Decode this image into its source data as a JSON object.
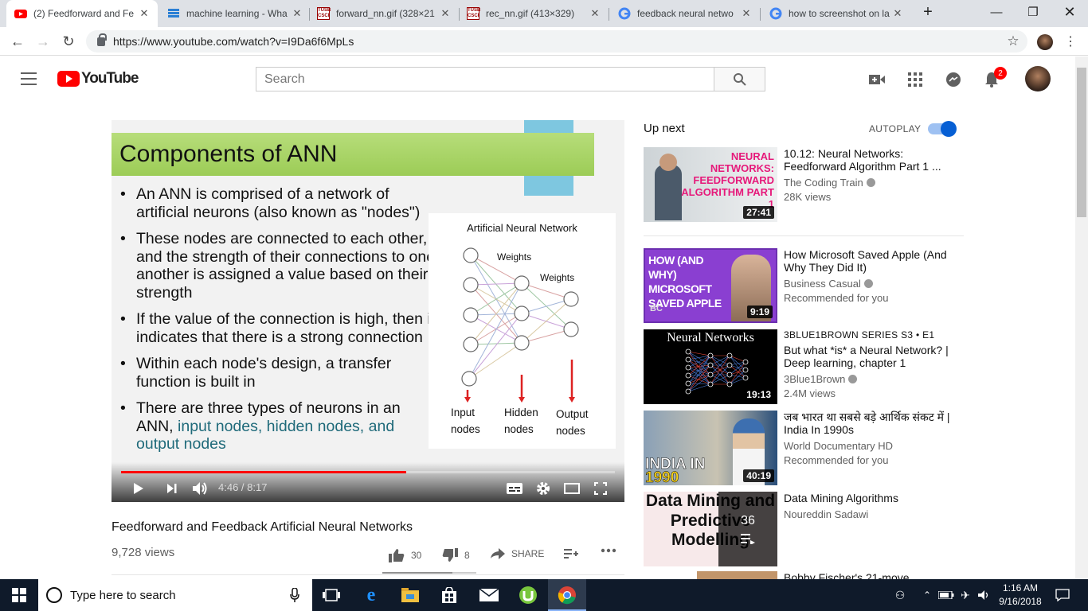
{
  "browser": {
    "tabs": [
      {
        "title": "(2) Feedforward and Fe",
        "active": true,
        "icon": "youtube-favicon"
      },
      {
        "title": "machine learning - Wha",
        "active": false,
        "icon": "stackexchange-favicon"
      },
      {
        "title": "forward_nn.gif (328×21",
        "active": false,
        "icon": "usc-csci-favicon"
      },
      {
        "title": "rec_nn.gif (413×329)",
        "active": false,
        "icon": "usc-csci-favicon"
      },
      {
        "title": "feedback neural netwo",
        "active": false,
        "icon": "google-favicon"
      },
      {
        "title": "how to screenshot on la",
        "active": false,
        "icon": "google-favicon"
      }
    ],
    "url": "https://www.youtube.com/watch?v=I9Da6f6MpLs",
    "fav_csci_top": "TUSB",
    "fav_csci_bottom": "CSCI"
  },
  "youtube": {
    "logo_text": "YouTube",
    "search_placeholder": "Search",
    "notification_count": "2"
  },
  "video": {
    "slide": {
      "title": "Components of ANN",
      "bullets": [
        "An ANN is comprised of a network of artificial neurons (also known as \"nodes\")",
        "These nodes are connected to each other, and the strength of their connections to one another is assigned a value based on their strength",
        "If the value of the connection is high, then it indicates that there is a strong connection",
        "Within each node's design, a transfer function is built in"
      ],
      "last_bullet_plain": "There are three types of neurons in an ANN,",
      "last_bullet_highlight": "input nodes, hidden nodes, and output nodes",
      "diagram": {
        "title": "Artificial Neural Network",
        "weights_1": "Weights",
        "weights_2": "Weights",
        "label_input": "Input nodes",
        "label_hidden": "Hidden nodes",
        "label_output": "Output nodes"
      }
    },
    "progress_fraction": 0.578,
    "time_current": "4:46",
    "time_total": "8:17",
    "title": "Feedforward and Feedback Artificial Neural Networks",
    "views": "9,728 views",
    "likes": "30",
    "dislikes": "8",
    "share_label": "SHARE"
  },
  "sidebar": {
    "up_next": "Up next",
    "autoplay_label": "AUTOPLAY",
    "autoplay_on": true,
    "items": [
      {
        "title": "10.12: Neural Networks: Feedforward Algorithm Part 1 ...",
        "channel": "The Coding Train",
        "meta": "28K views",
        "duration": "27:41",
        "thumb_text": "NEURAL NETWORKS: FEEDFORWARD ALGORITHM PART 1"
      },
      {
        "title": "How Microsoft Saved Apple (And Why They Did It)",
        "channel": "Business Casual",
        "meta": "Recommended for you",
        "duration": "9:19",
        "thumb_text": "HOW (AND WHY) MICROSOFT SAVED APPLE",
        "thumb_corner": "BC"
      },
      {
        "series": "3BLUE1BROWN SERIES  S3 • E1",
        "title": "But what *is* a Neural Network? | Deep learning, chapter 1",
        "channel": "3Blue1Brown",
        "meta": "2.4M views",
        "duration": "19:13",
        "thumb_text": "Neural Networks"
      },
      {
        "title": "जब भारत था सबसे बड़े आर्थिक संकट में | India In 1990s",
        "channel": "World Documentary HD",
        "meta": "Recommended for you",
        "duration": "40:19",
        "thumb_text_1": "INDIA IN",
        "thumb_text_2": "1990"
      },
      {
        "title": "Data Mining Algorithms",
        "channel": "Noureddin Sadawi",
        "playlist_count": "36",
        "thumb_text": "Data Mining and Predictive Modelling"
      },
      {
        "title": "Bobby Fischer's 21-move"
      }
    ]
  },
  "taskbar": {
    "search_placeholder": "Type here to search",
    "time": "1:16 AM",
    "date": "9/16/2018"
  }
}
